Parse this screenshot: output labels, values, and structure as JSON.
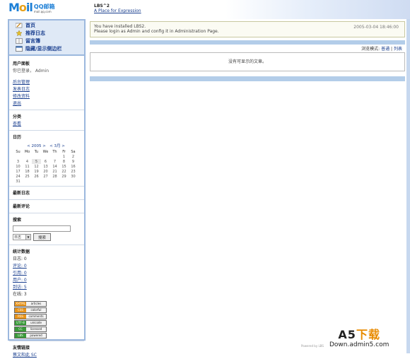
{
  "header": {
    "logo_text_blue": "M",
    "logo_text_o": "o",
    "logo_text_rest": "il",
    "logo_qq": "QQ邮箱",
    "logo_domain": "mail.qq.com",
    "site_title": "LBS^2",
    "site_tagline": "A Place for Expression"
  },
  "nav": {
    "items": [
      {
        "label": "首页",
        "icon": "pencil-icon"
      },
      {
        "label": "推荐日志",
        "icon": "star-icon"
      },
      {
        "label": "留言簿",
        "icon": "book-icon"
      },
      {
        "label": "隐藏/显示侧边栏",
        "icon": "window-icon"
      }
    ]
  },
  "user_panel": {
    "title": "用户面板",
    "status": "你已登录， Admin",
    "links": [
      "后台管理",
      "发表日志",
      "修改资料",
      "退出"
    ]
  },
  "category": {
    "title": "分类",
    "items": [
      "查看"
    ]
  },
  "calendar": {
    "title": "日历",
    "prev": "<",
    "year": "2005",
    "month": "3月",
    "next": ">",
    "weekdays": [
      "Su",
      "Mo",
      "Tu",
      "We",
      "Th",
      "Fr",
      "Sa"
    ],
    "rows": [
      [
        "",
        "",
        "",
        "",
        "",
        "1",
        "2"
      ],
      [
        "3",
        "4",
        "5",
        "6",
        "7",
        "8",
        "9"
      ],
      [
        "10",
        "11",
        "12",
        "13",
        "14",
        "15",
        "16"
      ],
      [
        "17",
        "18",
        "19",
        "20",
        "21",
        "22",
        "23"
      ],
      [
        "24",
        "25",
        "26",
        "27",
        "28",
        "29",
        "30"
      ],
      [
        "31",
        "",
        "",
        "",
        "",
        "",
        ""
      ]
    ],
    "today": "5"
  },
  "recent_entries": {
    "title": "最新日志"
  },
  "recent_comments": {
    "title": "最新评论"
  },
  "search": {
    "title": "搜索",
    "input_value": "",
    "select_value": "日志",
    "button_label": "搜索"
  },
  "stats": {
    "title": "统计数据",
    "lines": [
      "日志: 0",
      "评论: 0",
      "引用: 0",
      "用户: 0",
      "到访: 5",
      "在线: 3"
    ]
  },
  "badges": [
    {
      "left": "XHTML",
      "right": "articles",
      "color": "#e8941a"
    },
    {
      "left": "CSS",
      "right": "colorful",
      "color": "#e8941a"
    },
    {
      "left": "RSS",
      "right": "comments",
      "color": "#e8941a"
    },
    {
      "left": "UTF-8",
      "right": "unicode",
      "color": "#3a9a3a"
    },
    {
      "left": "CC",
      "right": "licensed",
      "color": "#3a9a3a"
    },
    {
      "left": "LBS",
      "right": "powered",
      "color": "#3a9a3a"
    }
  ],
  "friend_links": {
    "title": "友情链接",
    "items": [
      "蔡文和此 SC"
    ]
  },
  "main": {
    "notice_line1": "You have installed LBS2.",
    "notice_line2": "Please login as Admin and config it in Administration Page.",
    "notice_time": "2005-03-04 18:46:00",
    "view_mode_label": "浏览模式:",
    "view_mode_normal": "普通",
    "view_mode_sep": "|",
    "view_mode_list": "列表",
    "empty_text": "没有可显示的文章。"
  },
  "footer": {
    "powered": "Powered by LBS"
  },
  "watermark": {
    "line1_a": "A5",
    "line1_b": "下载",
    "line2": "Down.admin5.com"
  }
}
